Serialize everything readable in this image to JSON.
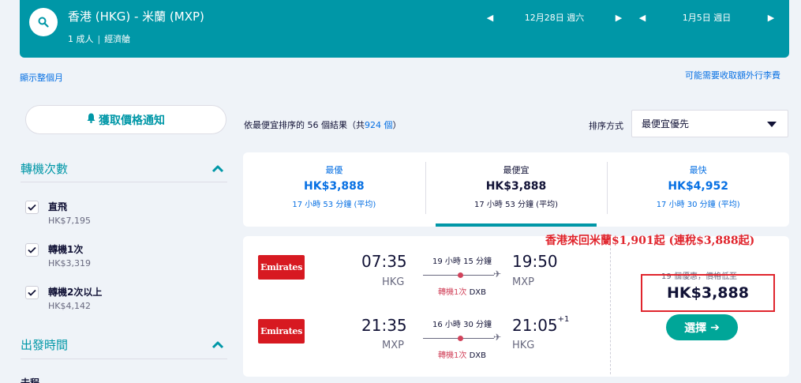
{
  "header": {
    "route": "香港 (HKG) - 米蘭 (MXP)",
    "passengers": "1 成人",
    "cabin": "經濟艙",
    "depart_date": "12月28日 週六",
    "return_date": "1月5日 週日"
  },
  "links": {
    "show_month": "顯示整個月",
    "baggage_fees": "可能需要收取額外行李費"
  },
  "sidebar": {
    "price_alert": "獲取價格通知",
    "stops_title": "轉機次數",
    "stops": [
      {
        "label": "直飛",
        "price": "HK$7,195",
        "checked": true
      },
      {
        "label": "轉機1次",
        "price": "HK$3,319",
        "checked": true
      },
      {
        "label": "轉機2次以上",
        "price": "HK$4,142",
        "checked": true
      }
    ],
    "departure_title": "出發時間",
    "outbound_label": "去程"
  },
  "results": {
    "count_text": "依最便宜排序的 56 個結果（共",
    "total": "924 個",
    "close": "）",
    "sort_label": "排序方式",
    "sort_value": "最便宜優先"
  },
  "tabs": [
    {
      "name": "最優",
      "price": "HK$3,888",
      "duration": "17 小時 53 分鐘 (平均)",
      "active": false
    },
    {
      "name": "最便宜",
      "price": "HK$3,888",
      "duration": "17 小時 53 分鐘 (平均)",
      "active": true
    },
    {
      "name": "最快",
      "price": "HK$4,952",
      "duration": "17 小時 30 分鐘 (平均)",
      "active": false
    }
  ],
  "card": {
    "outbound": {
      "airline": "Emirates",
      "depart_time": "07:35",
      "depart_code": "HKG",
      "duration": "19 小時 15 分鐘",
      "stops": "轉機1次",
      "via": "DXB",
      "arrive_time": "19:50",
      "arrive_code": "MXP",
      "day_offset": ""
    },
    "inbound": {
      "airline": "Emirates",
      "depart_time": "21:35",
      "depart_code": "MXP",
      "duration": "16 小時 30 分鐘",
      "stops": "轉機1次",
      "via": "DXB",
      "arrive_time": "21:05",
      "arrive_code": "HKG",
      "day_offset": "+1"
    },
    "deals_text": "19 個優惠，價格低至",
    "price": "HK$3,888",
    "select_label": "選擇"
  },
  "annotation": "香港來回米蘭$1,901起 (連稅$3,888起)",
  "colors": {
    "brand": "#0097a7",
    "link": "#0770e3",
    "select": "#00a698",
    "annotation": "#e0252d",
    "airline": "#d71921"
  }
}
